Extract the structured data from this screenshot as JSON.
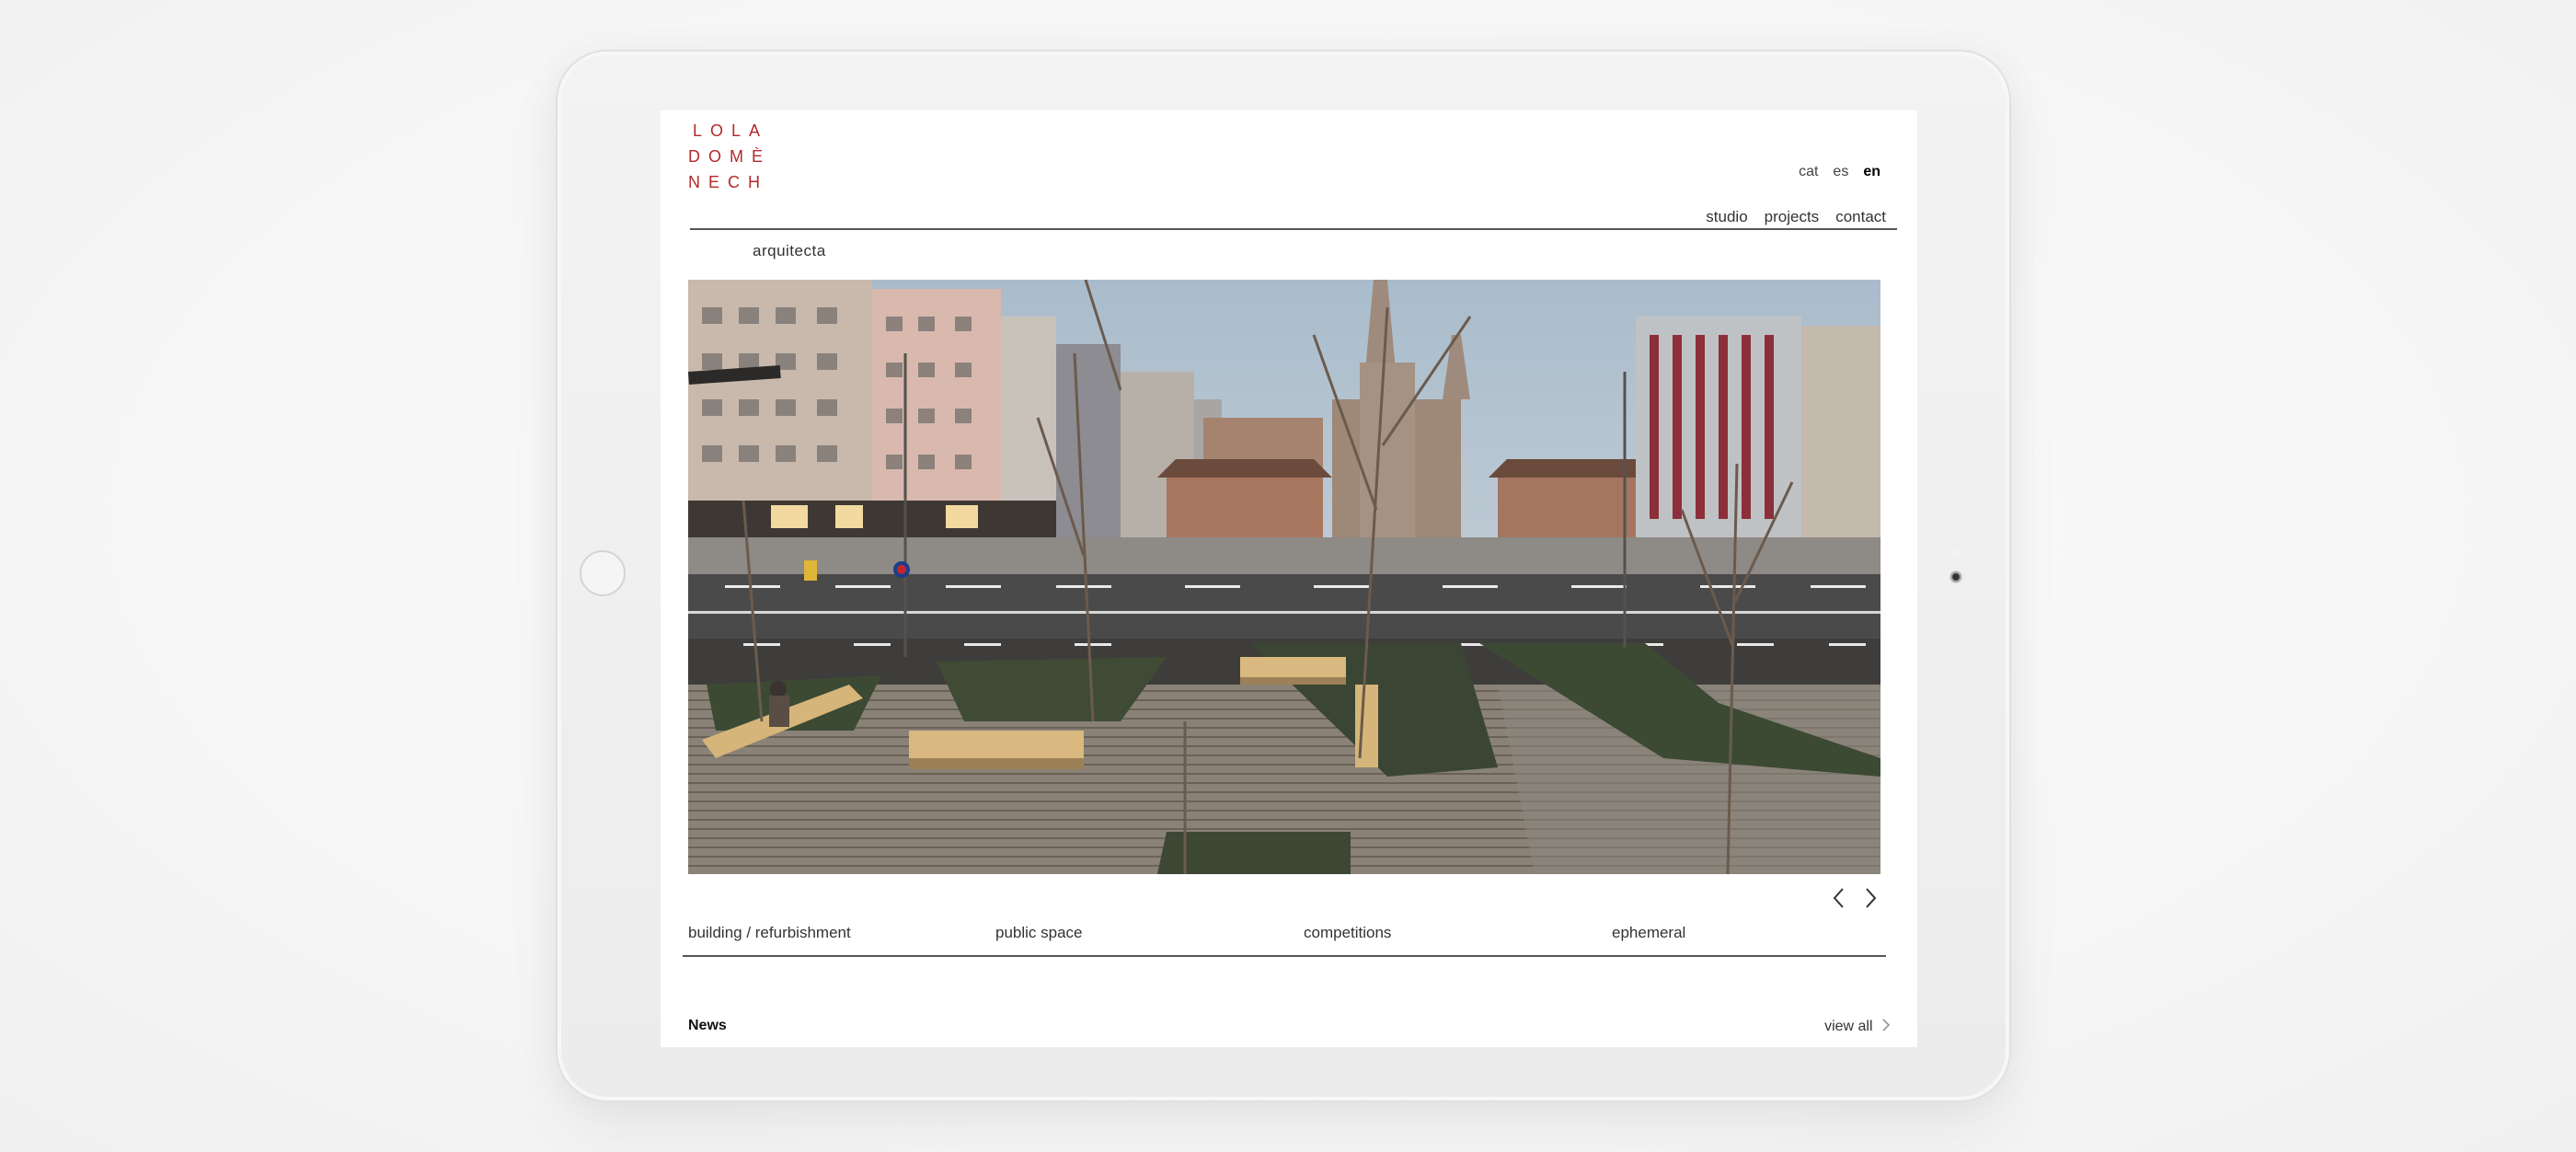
{
  "logo": {
    "line1": "LOLA",
    "line2": "DOMÈ",
    "line3": "NECH",
    "subtitle": "arquitecta",
    "color": "#b5282b"
  },
  "languages": [
    {
      "label": "cat",
      "active": false
    },
    {
      "label": "es",
      "active": false
    },
    {
      "label": "en",
      "active": true
    }
  ],
  "nav": {
    "studio": "studio",
    "projects": "projects",
    "contact": "contact"
  },
  "carousel": {
    "prev_icon": "chevron-left-icon",
    "next_icon": "chevron-right-icon"
  },
  "categories": [
    "building / refurbishment",
    "public space",
    "competitions",
    "ephemeral"
  ],
  "news": {
    "title": "News",
    "view_all": "view all"
  }
}
